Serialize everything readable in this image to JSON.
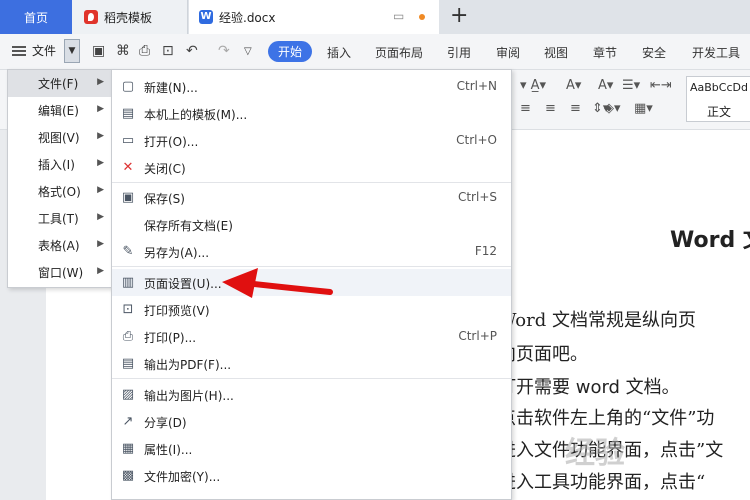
{
  "tabs": {
    "home": "首页",
    "template": "稻壳模板",
    "doc": "经验.docx",
    "doc_icon": "W"
  },
  "ribbon": {
    "file_label": "文件",
    "tabs": [
      "开始",
      "插入",
      "页面布局",
      "引用",
      "审阅",
      "视图",
      "章节",
      "安全",
      "开发工具"
    ],
    "active_tab": "开始",
    "style_sample": "AaBbCcDd",
    "style_label": "正文"
  },
  "left_menu": {
    "items": [
      {
        "label": "文件(F)"
      },
      {
        "label": "编辑(E)"
      },
      {
        "label": "视图(V)"
      },
      {
        "label": "插入(I)"
      },
      {
        "label": "格式(O)"
      },
      {
        "label": "工具(T)"
      },
      {
        "label": "表格(A)"
      },
      {
        "label": "窗口(W)"
      }
    ]
  },
  "file_menu": {
    "items": [
      {
        "label": "新建(N)...",
        "shortcut": "Ctrl+N",
        "icon": "new-doc-icon"
      },
      {
        "label": "本机上的模板(M)...",
        "shortcut": "",
        "icon": "template-icon"
      },
      {
        "label": "打开(O)...",
        "shortcut": "Ctrl+O",
        "icon": "folder-icon"
      },
      {
        "label": "关闭(C)",
        "shortcut": "",
        "icon": "close-doc-icon"
      },
      {
        "label": "保存(S)",
        "shortcut": "Ctrl+S",
        "icon": "save-icon"
      },
      {
        "label": "保存所有文档(E)",
        "shortcut": "",
        "icon": ""
      },
      {
        "label": "另存为(A)...",
        "shortcut": "F12",
        "icon": "save-as-icon"
      },
      {
        "label": "页面设置(U)...",
        "shortcut": "",
        "icon": "page-setup-icon"
      },
      {
        "label": "打印预览(V)",
        "shortcut": "",
        "icon": "print-preview-icon"
      },
      {
        "label": "打印(P)...",
        "shortcut": "Ctrl+P",
        "icon": "print-icon"
      },
      {
        "label": "输出为PDF(F)...",
        "shortcut": "",
        "icon": "pdf-icon"
      },
      {
        "label": "输出为图片(H)...",
        "shortcut": "",
        "icon": "image-icon"
      },
      {
        "label": "分享(D)",
        "shortcut": "",
        "icon": "share-icon"
      },
      {
        "label": "属性(I)...",
        "shortcut": "",
        "icon": "properties-icon"
      },
      {
        "label": "文件加密(Y)...",
        "shortcut": "",
        "icon": "encrypt-icon"
      }
    ]
  },
  "document": {
    "title": "Word 文",
    "lines": [
      "Word 文档常规是纵向页",
      "向页面吧。",
      "打开需要 word 文档。",
      "点击软件左上角的“文件”功",
      "进入文件功能界面，点击”文",
      "进入工具功能界面，点击“"
    ],
    "watermark": "经验"
  },
  "colors": {
    "accent": "#3d73e6",
    "arrow": "#e01010"
  }
}
